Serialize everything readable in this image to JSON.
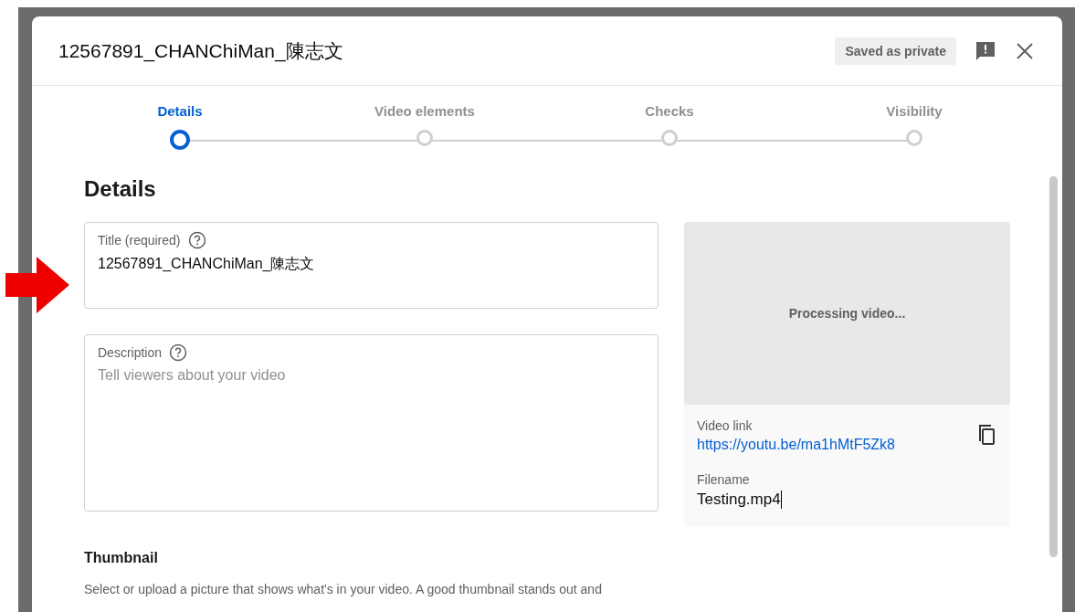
{
  "dialog": {
    "title": "12567891_CHANChiMan_陳志文",
    "save_status": "Saved as private"
  },
  "stepper": [
    {
      "label": "Details",
      "selected": true
    },
    {
      "label": "Video elements",
      "selected": false
    },
    {
      "label": "Checks",
      "selected": false
    },
    {
      "label": "Visibility",
      "selected": false
    }
  ],
  "heading": "Details",
  "fields": [
    {
      "label": "Title (required)",
      "value": "12567891_CHANChiMan_陳志文"
    },
    {
      "label": "Description",
      "placeholder": "Tell viewers about your video"
    }
  ],
  "thumbnail": {
    "heading": "Thumbnail",
    "description": "Select or upload a picture that shows what's in your video. A good thumbnail stands out and"
  },
  "preview": {
    "status": "Processing video...",
    "link_label": "Video link",
    "link": "https://youtu.be/ma1hMtF5Zk8",
    "filename_label": "Filename",
    "filename": "Testing.mp4"
  }
}
